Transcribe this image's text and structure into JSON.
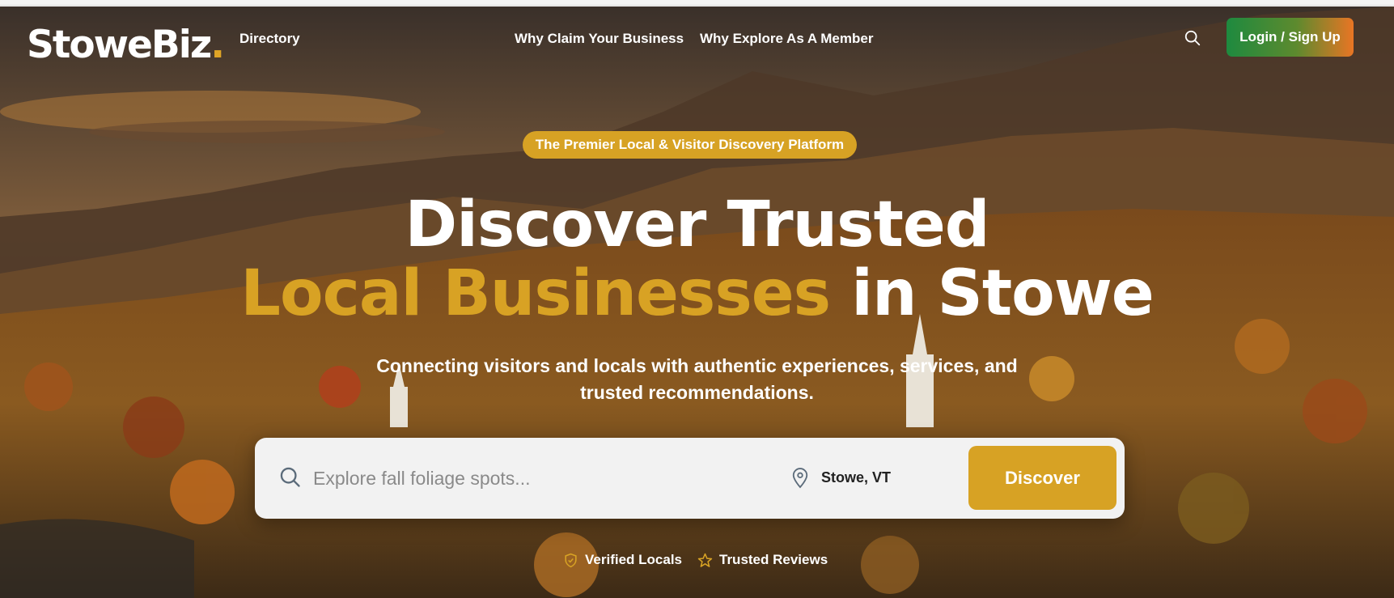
{
  "brand": {
    "name": "StoweBiz",
    "dot": ".",
    "accent": "#d7a224"
  },
  "nav": {
    "directory": "Directory",
    "why_claim": "Why Claim Your Business",
    "why_explore": "Why Explore As A Member",
    "search_icon": "search-icon",
    "login": "Login / Sign Up"
  },
  "hero": {
    "badge": "The Premier Local & Visitor Discovery Platform",
    "headline_line1": "Discover Trusted",
    "headline_highlight": "Local Businesses",
    "headline_line2_rest": " in Stowe",
    "subtitle_line1": "Connecting visitors and locals with authentic experiences, services, and",
    "subtitle_line2": "trusted recommendations."
  },
  "search": {
    "placeholder": "Explore fall foliage spots...",
    "value": "",
    "location": "Stowe, VT",
    "button": "Discover"
  },
  "trust_badges": [
    {
      "icon": "shield-check-icon",
      "label": "Verified Locals"
    },
    {
      "icon": "star-icon",
      "label": "Trusted Reviews"
    }
  ],
  "colors": {
    "gold": "#d7a224",
    "login_green": "#1e8a3f",
    "login_orange": "#e97524"
  }
}
